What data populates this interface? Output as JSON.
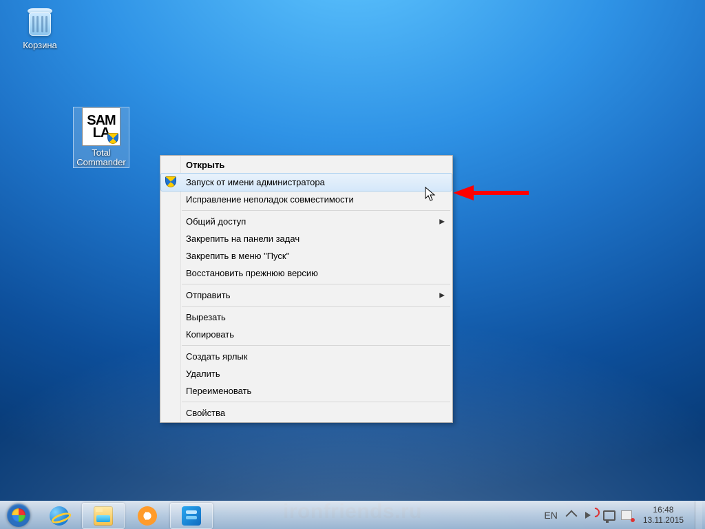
{
  "desktop": {
    "icons": {
      "recycle_bin": {
        "label": "Корзина"
      },
      "total_commander": {
        "label_line1": "Total",
        "label_line2": "Commander",
        "art_line1": "SAM",
        "art_line2": "LA"
      }
    }
  },
  "context_menu": {
    "items": [
      {
        "label": "Открыть",
        "bold": true
      },
      {
        "label": "Запуск от имени администратора",
        "shield": true,
        "highlighted": true
      },
      {
        "label": "Исправление неполадок совместимости"
      },
      {
        "sep": true
      },
      {
        "label": "Общий доступ",
        "submenu": true
      },
      {
        "label": "Закрепить на панели задач"
      },
      {
        "label": "Закрепить в меню \"Пуск\""
      },
      {
        "label": "Восстановить прежнюю версию"
      },
      {
        "sep": true
      },
      {
        "label": "Отправить",
        "submenu": true
      },
      {
        "sep": true
      },
      {
        "label": "Вырезать"
      },
      {
        "label": "Копировать"
      },
      {
        "sep": true
      },
      {
        "label": "Создать ярлык"
      },
      {
        "label": "Удалить"
      },
      {
        "label": "Переименовать"
      },
      {
        "sep": true
      },
      {
        "label": "Свойства"
      }
    ],
    "submenu_glyph": "▶"
  },
  "taskbar": {
    "language": "EN",
    "time": "16:48",
    "date": "13.11.2015"
  },
  "watermark": "ironfriends.ru"
}
